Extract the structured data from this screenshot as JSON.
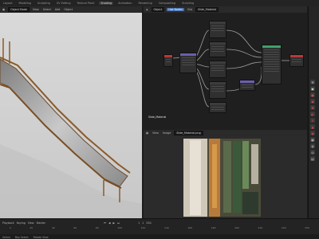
{
  "workspace_tabs": [
    "Layout",
    "Modeling",
    "Sculpting",
    "UV Editing",
    "Texture Paint",
    "Shading",
    "Animation",
    "Rendering",
    "Compositing",
    "Scripting"
  ],
  "active_tab_index": 5,
  "viewport": {
    "mode": "Object Mode",
    "view": "View",
    "select": "Select",
    "add": "Add",
    "object": "Object"
  },
  "node_editor": {
    "object_label": "Object",
    "menus": [
      "View",
      "Select",
      "Add",
      "Node"
    ],
    "use_nodes": "Use Nodes",
    "slot": "Slot",
    "material": "Slide_Material",
    "footer_label": "Slide_Material"
  },
  "image_editor": {
    "menus": [
      "View",
      "Image"
    ],
    "image_name": "Slide_Material.png"
  },
  "timeline": {
    "controls": [
      "Playback",
      "Keying",
      "View",
      "Marker"
    ],
    "frame": "1",
    "start": "1",
    "end": "250",
    "ruler": [
      "0",
      "20",
      "40",
      "60",
      "80",
      "100",
      "120",
      "140",
      "160",
      "180",
      "200",
      "220",
      "240",
      "250"
    ]
  },
  "status": [
    "Select",
    "Box Select",
    "Rotate View"
  ],
  "colors": {
    "accent": "#4772b3",
    "image_node": "#b5473a",
    "shader_node": "#3fa06c",
    "output_node": "#b53a3a"
  }
}
